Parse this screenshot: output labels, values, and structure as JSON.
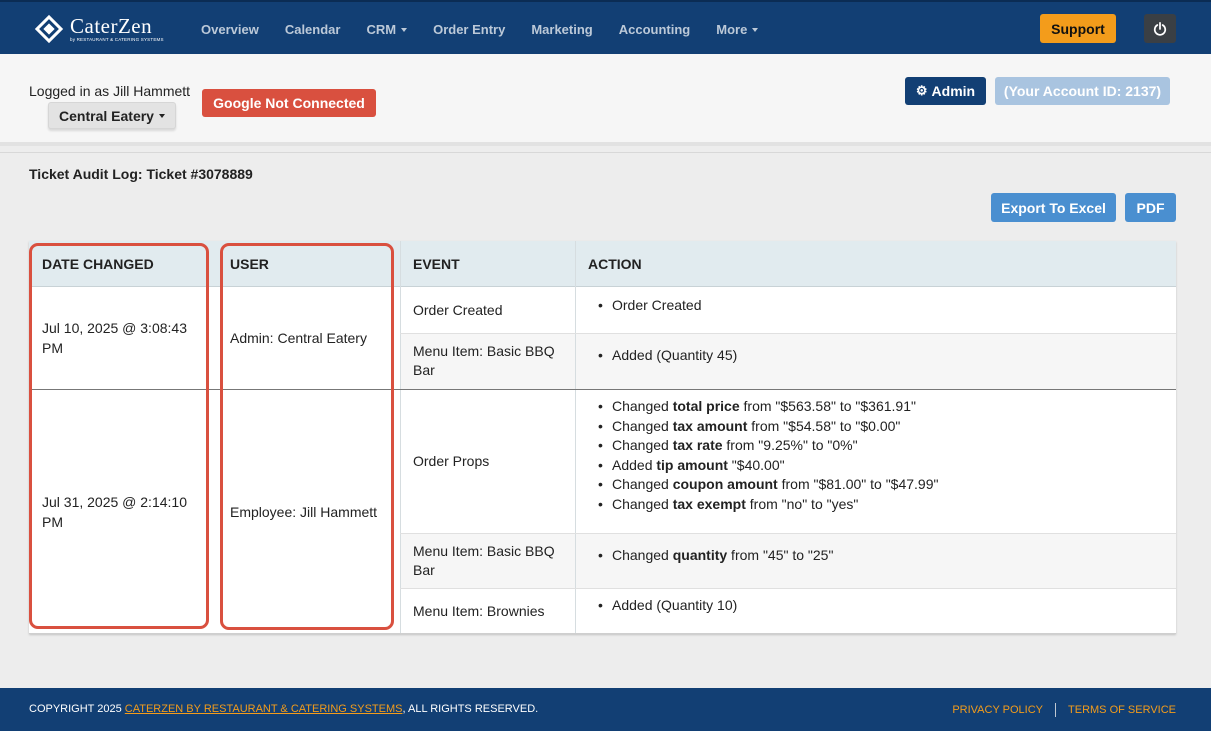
{
  "app": {
    "logo_name": "CaterZen",
    "logo_sub": "by RESTAURANT & CATERING SYSTEMS"
  },
  "nav": {
    "items": [
      {
        "label": "Overview",
        "dropdown": false
      },
      {
        "label": "Calendar",
        "dropdown": false
      },
      {
        "label": "CRM",
        "dropdown": true
      },
      {
        "label": "Order Entry",
        "dropdown": false
      },
      {
        "label": "Marketing",
        "dropdown": false
      },
      {
        "label": "Accounting",
        "dropdown": false
      },
      {
        "label": "More",
        "dropdown": true
      }
    ],
    "support_label": "Support"
  },
  "account": {
    "logged_in": "Logged in as Jill Hammett",
    "location": "Central Eatery",
    "google_status": "Google Not Connected",
    "admin_label": "Admin",
    "account_id": "(Your Account ID: 2137)"
  },
  "page": {
    "title": "Ticket Audit Log: Ticket #3078889",
    "export_label": "Export To Excel",
    "pdf_label": "PDF"
  },
  "table": {
    "headers": [
      "DATE CHANGED",
      "USER",
      "EVENT",
      "ACTION"
    ],
    "groups": [
      {
        "date": "Jul 10, 2025 @ 3:08:43 PM",
        "user": "Admin: Central Eatery",
        "rows": [
          {
            "event": "Order Created",
            "actions": [
              [
                {
                  "t": "Order Created",
                  "b": false
                }
              ]
            ]
          },
          {
            "event": "Menu Item: Basic BBQ Bar",
            "actions": [
              [
                {
                  "t": "Added (Quantity 45)",
                  "b": false
                }
              ]
            ]
          }
        ]
      },
      {
        "date": "Jul 31, 2025 @ 2:14:10 PM",
        "user": "Employee: Jill Hammett",
        "rows": [
          {
            "event": "Order Props",
            "actions": [
              [
                {
                  "t": "Changed ",
                  "b": false
                },
                {
                  "t": "total price",
                  "b": true
                },
                {
                  "t": " from \"$563.58\" to \"$361.91\"",
                  "b": false
                }
              ],
              [
                {
                  "t": "Changed ",
                  "b": false
                },
                {
                  "t": "tax amount",
                  "b": true
                },
                {
                  "t": " from \"$54.58\" to \"$0.00\"",
                  "b": false
                }
              ],
              [
                {
                  "t": "Changed ",
                  "b": false
                },
                {
                  "t": "tax rate",
                  "b": true
                },
                {
                  "t": " from \"9.25%\" to \"0%\"",
                  "b": false
                }
              ],
              [
                {
                  "t": "Added ",
                  "b": false
                },
                {
                  "t": "tip amount",
                  "b": true
                },
                {
                  "t": " \"$40.00\"",
                  "b": false
                }
              ],
              [
                {
                  "t": "Changed ",
                  "b": false
                },
                {
                  "t": "coupon amount",
                  "b": true
                },
                {
                  "t": " from \"$81.00\" to \"$47.99\"",
                  "b": false
                }
              ],
              [
                {
                  "t": "Changed ",
                  "b": false
                },
                {
                  "t": "tax exempt",
                  "b": true
                },
                {
                  "t": " from \"no\" to \"yes\"",
                  "b": false
                }
              ]
            ]
          },
          {
            "event": "Menu Item: Basic BBQ Bar",
            "actions": [
              [
                {
                  "t": "Changed ",
                  "b": false
                },
                {
                  "t": "quantity",
                  "b": true
                },
                {
                  "t": " from \"45\" to \"25\"",
                  "b": false
                }
              ]
            ]
          },
          {
            "event": "Menu Item: Brownies",
            "actions": [
              [
                {
                  "t": "Added (Quantity 10)",
                  "b": false
                }
              ]
            ]
          }
        ]
      }
    ]
  },
  "footer": {
    "copyright_prefix": "COPYRIGHT 2025 ",
    "copyright_link": "CATERZEN BY RESTAURANT & CATERING SYSTEMS",
    "copyright_suffix": ", ALL RIGHTS RESERVED.",
    "privacy": "PRIVACY POLICY",
    "terms": "TERMS OF SERVICE"
  },
  "colors": {
    "nav_bg": "#123f74",
    "support": "#f39c1b",
    "danger": "#d9503f",
    "primary_light": "#4a8fd0",
    "highlight": "#d9503f"
  }
}
